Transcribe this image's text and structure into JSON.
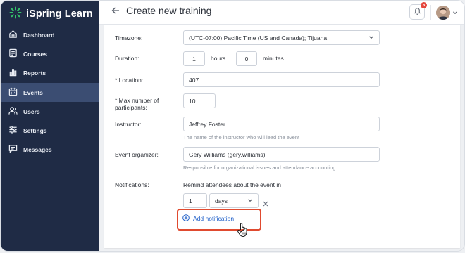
{
  "app": {
    "name": "iSpring Learn"
  },
  "header": {
    "title": "Create new training",
    "notification_count": "8"
  },
  "sidebar": {
    "items": [
      {
        "label": "Dashboard",
        "icon": "home-icon"
      },
      {
        "label": "Courses",
        "icon": "courses-icon"
      },
      {
        "label": "Reports",
        "icon": "reports-icon"
      },
      {
        "label": "Events",
        "icon": "calendar-icon",
        "active": true
      },
      {
        "label": "Users",
        "icon": "users-icon"
      },
      {
        "label": "Settings",
        "icon": "sliders-icon"
      },
      {
        "label": "Messages",
        "icon": "messages-icon"
      }
    ]
  },
  "form": {
    "timezone": {
      "label": "Timezone:",
      "value": "(UTC-07:00) Pacific Time (US and Canada); Tijuana"
    },
    "duration": {
      "label": "Duration:",
      "hours": "1",
      "hours_unit": "hours",
      "minutes": "0",
      "minutes_unit": "minutes"
    },
    "location": {
      "label": "* Location:",
      "value": "407"
    },
    "max_participants": {
      "label_line1": "* Max number of",
      "label_line2": "participants:",
      "value": "10"
    },
    "instructor": {
      "label": "Instructor:",
      "value": "Jeffrey Foster",
      "hint": "The name of the instructor who will lead the event"
    },
    "organizer": {
      "label": "Event organizer:",
      "value": "Gery Williams (gery.williams)",
      "hint": "Responsible for organizational issues and attendance accounting"
    },
    "notifications": {
      "label": "Notifications:",
      "description": "Remind attendees about the event in",
      "amount": "1",
      "unit": "days",
      "add_label": "Add notification"
    }
  },
  "colors": {
    "sidebar_bg": "#1f2b45",
    "sidebar_active": "#3b4d72",
    "logo_green": "#35c46b",
    "link_blue": "#1f5fc8",
    "highlight_red": "#e04a2f",
    "badge_red": "#e5483f"
  }
}
